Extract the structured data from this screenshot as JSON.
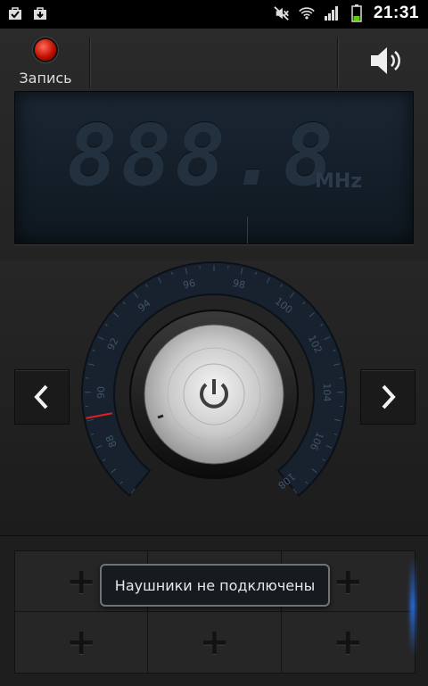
{
  "status_bar": {
    "time": "21:31",
    "icons": [
      "checklist-bag-icon",
      "download-bag-icon",
      "mute-icon",
      "wifi-icon",
      "signal-icon",
      "battery-icon"
    ],
    "battery_color": "#5bd000"
  },
  "toolbar": {
    "record_label": "Запись",
    "record_color": "#c01000"
  },
  "display": {
    "frequency": "888.8",
    "unit": "MHz",
    "lcd_color": "#23313f"
  },
  "dial": {
    "scale_min": 86,
    "scale_max": 108,
    "scale_labels": [
      "88",
      "90",
      "92",
      "94",
      "96",
      "98",
      "100",
      "102",
      "104",
      "106",
      "108"
    ],
    "current_frequency": 89.1,
    "marker_color": "#e02020"
  },
  "presets": {
    "cells": [
      "+",
      "+",
      "+",
      "+",
      "+",
      "+"
    ]
  },
  "toast": {
    "message": "Наушники не подключены"
  }
}
